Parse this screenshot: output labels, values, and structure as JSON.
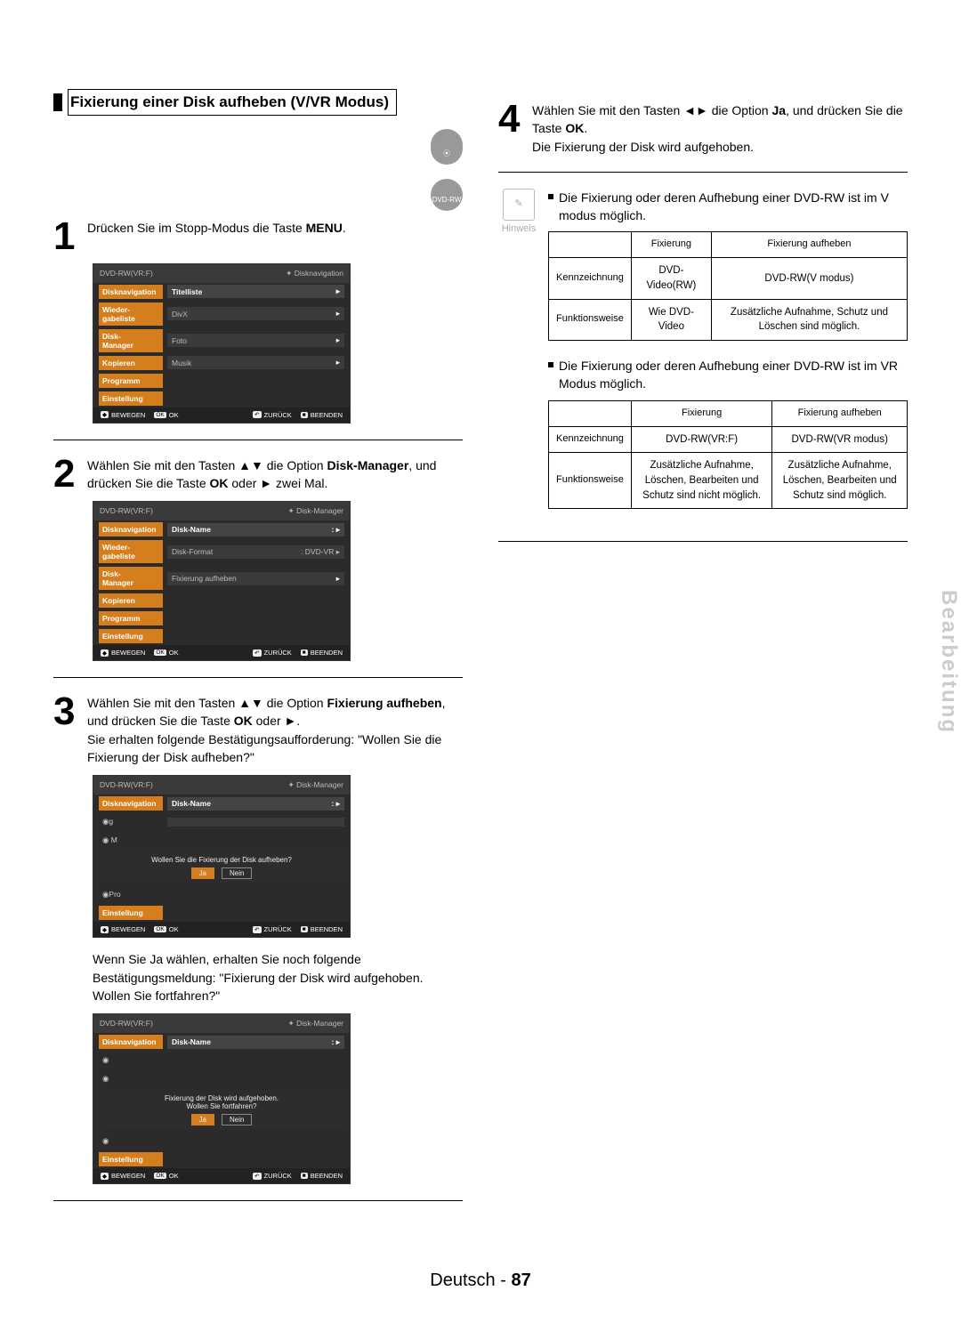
{
  "section_title": "Fixierung einer Disk aufheben (V/VR Modus)",
  "disc_badge": "DVD-RW",
  "steps": {
    "s1": {
      "num": "1",
      "text": "Drücken Sie im Stopp-Modus die Taste ",
      "bold": "MENU",
      "after": "."
    },
    "s2": {
      "num": "2",
      "pre": "Wählen Sie mit den Tasten ▲▼ die Option ",
      "bold": "Disk-Manager",
      "mid": ", und drücken Sie die Taste ",
      "bold2": "OK",
      "after": " oder ► zwei Mal."
    },
    "s3": {
      "num": "3",
      "pre": "Wählen Sie mit den Tasten ▲▼ die Option ",
      "bold": "Fixierung aufheben",
      "mid": ", und drücken Sie die Taste ",
      "bold2": "OK",
      "after": " oder ►.",
      "tail": "Sie erhalten folgende Bestätigungsaufforderung: \"Wollen Sie die Fixierung der Disk aufheben?\""
    },
    "s3b": "Wenn Sie Ja wählen, erhalten Sie noch folgende Bestätigungsmeldung: \"Fixierung der Disk wird aufgehoben. Wollen Sie fortfahren?\"",
    "s4": {
      "num": "4",
      "pre": "Wählen Sie mit den Tasten ◄► die Option ",
      "bold": "Ja",
      "mid": ", und drücken Sie die Taste ",
      "bold2": "OK",
      "after": ".",
      "tail": "Die Fixierung der Disk wird aufgehoben."
    }
  },
  "ui": {
    "header_left": "DVD-RW(VR:F)",
    "crumb_nav": "Disknavigation",
    "crumb_dm": "Disk-Manager",
    "side": {
      "nav": "Disknavigation",
      "wieder": "Wieder-\ngabeliste",
      "disk": "Disk-\nManager",
      "kopieren": "Kopieren",
      "prog": "Programm",
      "einst": "Einstellung"
    },
    "s1_items": [
      "Titelliste",
      "DivX",
      "Foto",
      "Musik"
    ],
    "s2_items": [
      [
        "Disk-Name",
        ": "
      ],
      [
        "Disk-Format",
        ": DVD-VR"
      ],
      [
        "Fixierung aufheben",
        ""
      ]
    ],
    "s3_prompt": "Wollen Sie die Fixierung der Disk aufheben?",
    "s3b_line1": "Fixierung der Disk wird aufgehoben.",
    "s3b_line2": "Wollen Sie fortfahren?",
    "s3_row": "Disk-Name",
    "yes": "Ja",
    "no": "Nein",
    "foot": {
      "move": "BEWEGEN",
      "ok": "OK",
      "back": "ZURÜCK",
      "exit": "BEENDEN"
    }
  },
  "note_label": "Hinweis",
  "note_items": [
    "Die Fixierung oder deren Aufhebung einer DVD-RW ist im V modus möglich.",
    "Die Fixierung oder deren Aufhebung einer DVD-RW ist im VR Modus möglich."
  ],
  "tab1": {
    "h1": "Fixierung",
    "h2": "Fixierung aufheben",
    "r1": {
      "lab": "Kennzeichnung",
      "c1": "DVD-Video(RW)",
      "c2": "DVD-RW(V modus)"
    },
    "r2": {
      "lab": "Funktionsweise",
      "c1": "Wie DVD-Video",
      "c2": "Zusätzliche Aufnahme, Schutz und Löschen sind möglich."
    }
  },
  "tab2": {
    "h1": "Fixierung",
    "h2": "Fixierung aufheben",
    "r1": {
      "lab": "Kennzeichnung",
      "c1": "DVD-RW(VR:F)",
      "c2": "DVD-RW(VR modus)"
    },
    "r2": {
      "lab": "Funktionsweise",
      "c1": "Zusätzliche Aufnahme, Löschen, Bearbeiten und Schutz sind nicht möglich.",
      "c2": "Zusätzliche Aufnahme, Löschen, Bearbeiten und Schutz sind möglich."
    }
  },
  "footer": {
    "lang": "Deutsch",
    "page": "87"
  },
  "sidetab": "Bearbeitung"
}
